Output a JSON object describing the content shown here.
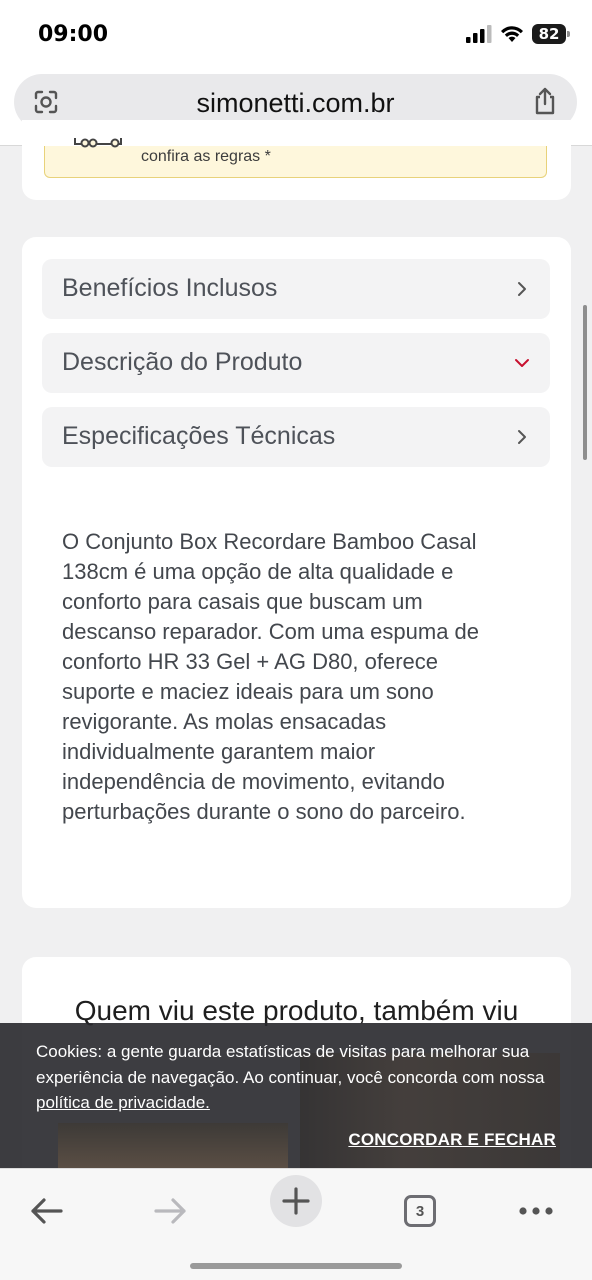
{
  "status_bar": {
    "time": "09:00",
    "battery": "82"
  },
  "browser": {
    "url": "simonetti.com.br",
    "tabs_count": "3"
  },
  "notice": {
    "text": "confira as regras *"
  },
  "accordions": [
    {
      "label": "Benefícios Inclusos",
      "state": "collapsed"
    },
    {
      "label": "Descrição do Produto",
      "state": "expanded"
    },
    {
      "label": "Especificações Técnicas",
      "state": "collapsed"
    }
  ],
  "description": {
    "lines": [
      "O Conjunto Box Recordare Bamboo Casal",
      "138cm é uma opção de alta qualidade e",
      "conforto para casais que buscam um",
      "descanso reparador. Com uma espuma de",
      "conforto HR 33 Gel + AG D80, oferece",
      "suporte e maciez ideais para um sono",
      "revigorante. As molas ensacadas",
      "individualmente garantem maior",
      "independência de movimento, evitando",
      "perturbações durante o sono do parceiro."
    ]
  },
  "related": {
    "title": "Quem viu este produto, também viu"
  },
  "cookie": {
    "line1": "Cookies: a gente guarda estatísticas de visitas para melhorar sua",
    "line2": "experiência de navegação. Ao continuar, você concorda com nossa",
    "link": "política de privacidade.",
    "button": "CONCORDAR E FECHAR"
  },
  "colors": {
    "expanded_chevron": "#c8102e",
    "notice_bg": "#fef7dc"
  }
}
